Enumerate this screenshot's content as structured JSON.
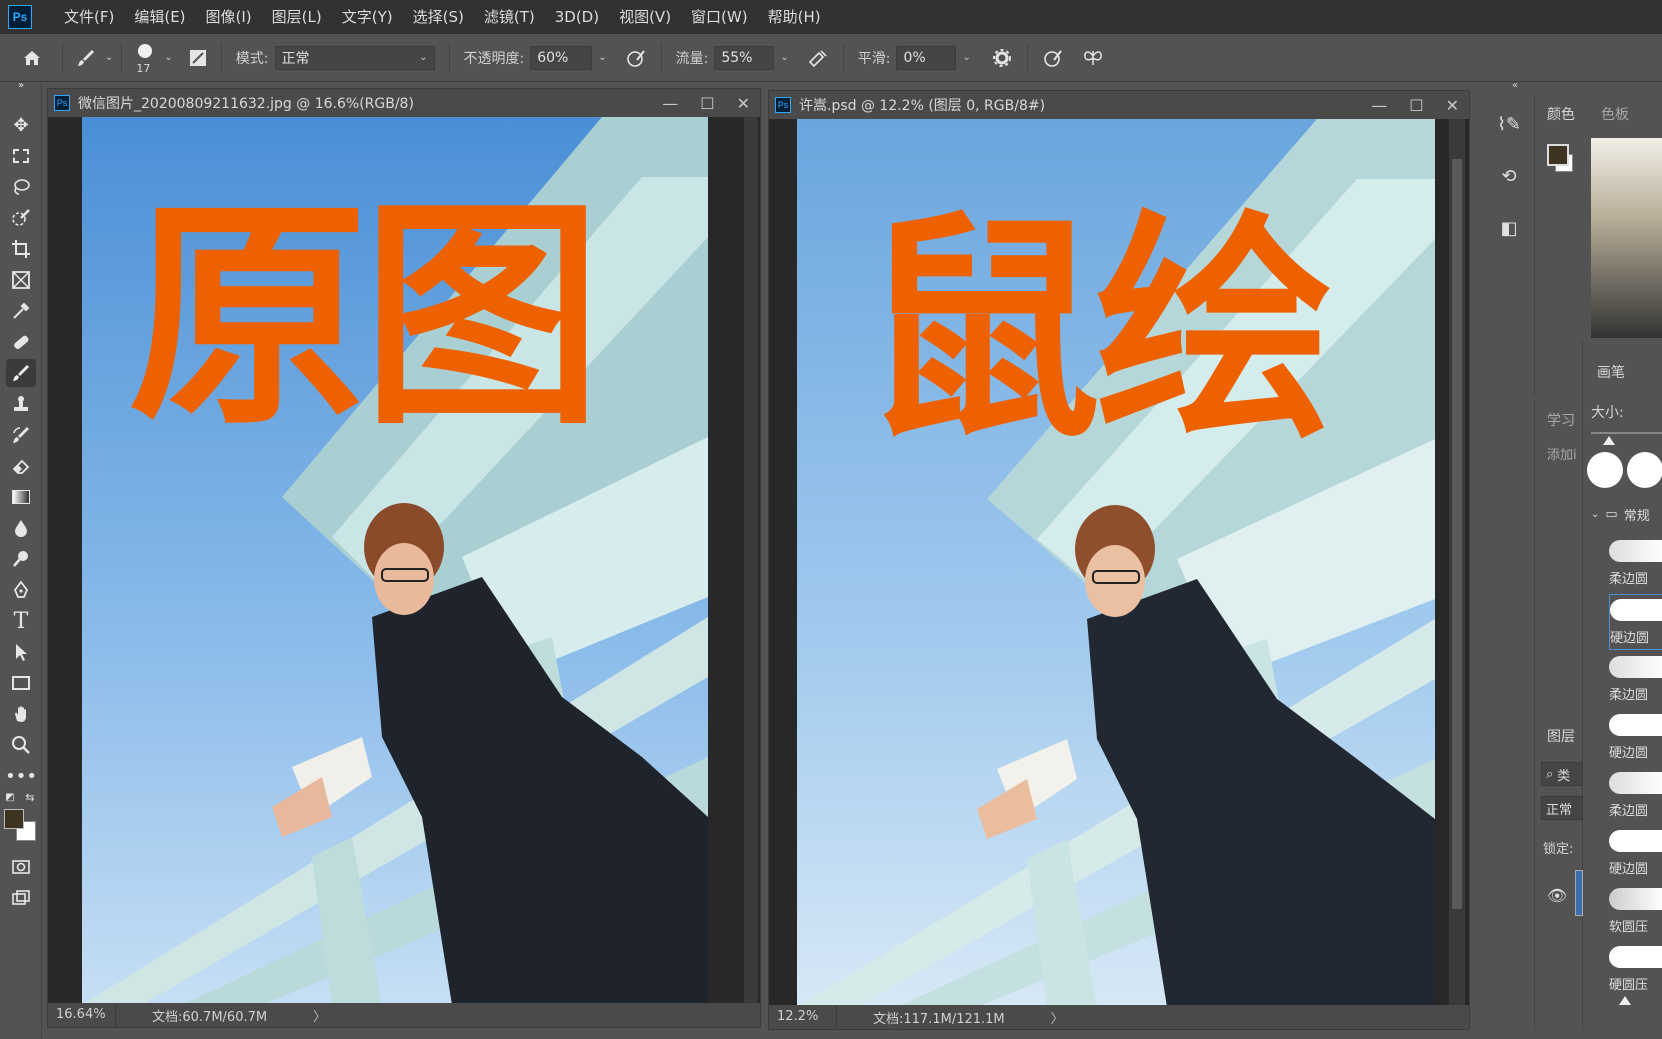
{
  "app": {
    "logo": "Ps"
  },
  "menu": [
    "文件(F)",
    "编辑(E)",
    "图像(I)",
    "图层(L)",
    "文字(Y)",
    "选择(S)",
    "滤镜(T)",
    "3D(D)",
    "视图(V)",
    "窗口(W)",
    "帮助(H)"
  ],
  "options": {
    "brush_size": "17",
    "mode_label": "模式:",
    "mode_value": "正常",
    "opacity_label": "不透明度:",
    "opacity_value": "60%",
    "flow_label": "流量:",
    "flow_value": "55%",
    "smooth_label": "平滑:",
    "smooth_value": "0%"
  },
  "doc1": {
    "ps": "Ps",
    "title": "微信图片_20200809211632.jpg @ 16.6%(RGB/8)",
    "overlay": "原图",
    "zoom": "16.64%",
    "docsize": "文档:60.7M/60.7M",
    "arrow": "〉"
  },
  "doc2": {
    "ps": "Ps",
    "title": "许嵩.psd @ 12.2% (图层 0, RGB/8#)",
    "overlay": "鼠绘",
    "zoom": "12.2%",
    "docsize": "文档:117.1M/121.1M",
    "arrow": "〉"
  },
  "window_buttons": {
    "minimize": "—",
    "maximize": "☐",
    "close": "✕"
  },
  "panels": {
    "color_tab": "颜色",
    "swatches_tab": "色板",
    "brush_tab": "画笔",
    "size_label": "大小:",
    "learn_tab": "学习",
    "learn_add": "添加i",
    "group_name": "常规",
    "layers_tab": "图层",
    "layers_search": "类",
    "layers_mode": "正常",
    "lock_label": "锁定:",
    "brushes": [
      "柔边圆",
      "硬边圆",
      "柔边圆",
      "硬边圆",
      "柔边圆",
      "硬边圆",
      "软圆压",
      "硬圆压"
    ]
  },
  "colors": {
    "accent_orange": "#ee6100",
    "foreground": "#3f3322",
    "background": "#ffffff"
  }
}
